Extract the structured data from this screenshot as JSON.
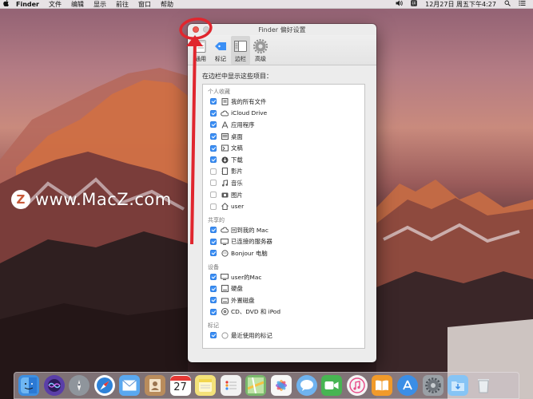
{
  "menubar": {
    "apple": "",
    "app_name": "Finder",
    "menus": [
      "文件",
      "编辑",
      "显示",
      "前往",
      "窗口",
      "帮助"
    ],
    "status_datetime": "12月27日 周五下午4:27"
  },
  "watermark": {
    "badge": "Z",
    "text": "www.MacZ.com"
  },
  "window": {
    "title": "Finder 偏好设置",
    "tabs": [
      {
        "label": "通用",
        "icon": "general-icon",
        "active": false
      },
      {
        "label": "标记",
        "icon": "tag-icon",
        "active": false
      },
      {
        "label": "边栏",
        "icon": "sidebar-icon",
        "active": true
      },
      {
        "label": "高级",
        "icon": "gear-icon",
        "active": false
      }
    ],
    "heading": "在边栏中显示这些项目：",
    "sections": [
      {
        "label": "个人收藏",
        "items": [
          {
            "label": "我的所有文件",
            "checked": true,
            "icon": "all-files-icon"
          },
          {
            "label": "iCloud Drive",
            "checked": true,
            "icon": "cloud-icon"
          },
          {
            "label": "应用程序",
            "checked": true,
            "icon": "applications-icon"
          },
          {
            "label": "桌面",
            "checked": true,
            "icon": "desktop-icon"
          },
          {
            "label": "文稿",
            "checked": true,
            "icon": "documents-icon"
          },
          {
            "label": "下载",
            "checked": true,
            "icon": "download-icon"
          },
          {
            "label": "影片",
            "checked": false,
            "icon": "movies-icon"
          },
          {
            "label": "音乐",
            "checked": false,
            "icon": "music-icon"
          },
          {
            "label": "图片",
            "checked": false,
            "icon": "pictures-icon"
          },
          {
            "label": "user",
            "checked": false,
            "icon": "home-icon"
          }
        ]
      },
      {
        "label": "共享的",
        "items": [
          {
            "label": "回到我的 Mac",
            "checked": true,
            "icon": "cloud-icon"
          },
          {
            "label": "已连接的服务器",
            "checked": true,
            "icon": "server-icon"
          },
          {
            "label": "Bonjour 电脑",
            "checked": true,
            "icon": "bonjour-icon"
          }
        ]
      },
      {
        "label": "设备",
        "items": [
          {
            "label": "user的Mac",
            "checked": true,
            "icon": "computer-icon"
          },
          {
            "label": "硬盘",
            "checked": true,
            "icon": "hard-disk-icon"
          },
          {
            "label": "外置磁盘",
            "checked": true,
            "icon": "external-disk-icon"
          },
          {
            "label": "CD、DVD 和 iPod",
            "checked": true,
            "icon": "optical-disc-icon"
          }
        ]
      },
      {
        "label": "标记",
        "items": [
          {
            "label": "最近使用的标记",
            "checked": true,
            "icon": "tag-circle-icon"
          }
        ]
      }
    ]
  },
  "dock": {
    "calendar_day": "27",
    "apps": [
      {
        "icon": "finder-icon",
        "color": "#3d8ee0"
      },
      {
        "icon": "siri-icon",
        "color": "#5a3ea8"
      },
      {
        "icon": "launchpad-icon",
        "color": "#8f959c"
      },
      {
        "icon": "safari-icon",
        "color": "#2f82d8"
      },
      {
        "icon": "mail-icon",
        "color": "#5aa8f0"
      },
      {
        "icon": "contacts-icon",
        "color": "#b98c5c"
      },
      {
        "icon": "calendar-icon",
        "color": "#ffffff"
      },
      {
        "icon": "notes-icon",
        "color": "#f4e27a"
      },
      {
        "icon": "reminders-icon",
        "color": "#f2f2f2"
      },
      {
        "icon": "maps-icon",
        "color": "#79b86c"
      },
      {
        "icon": "photos-icon",
        "color": "#f7f7f7"
      },
      {
        "icon": "messages-icon",
        "color": "#6fb3ef"
      },
      {
        "icon": "facetime-icon",
        "color": "#47b552"
      },
      {
        "icon": "itunes-icon",
        "color": "#f5f5f5"
      },
      {
        "icon": "ibooks-icon",
        "color": "#f19a2a"
      },
      {
        "icon": "app-store-icon",
        "color": "#3b8ee6"
      },
      {
        "icon": "system-preferences-icon",
        "color": "#9aa0a6"
      },
      {
        "icon": "downloads-stack-icon",
        "color": "#86c4f5"
      },
      {
        "icon": "trash-icon",
        "color": "#d8dde2"
      }
    ]
  }
}
